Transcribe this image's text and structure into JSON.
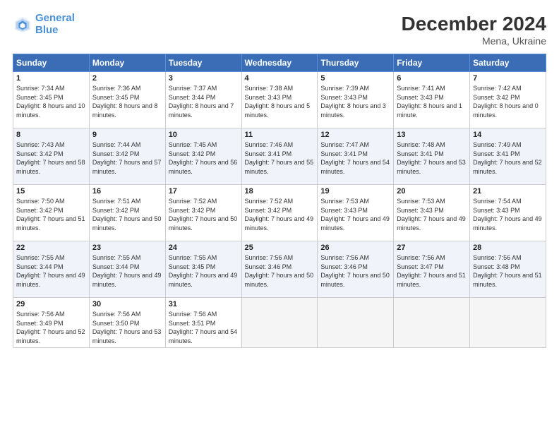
{
  "header": {
    "logo_line1": "General",
    "logo_line2": "Blue",
    "title": "December 2024",
    "subtitle": "Mena, Ukraine"
  },
  "columns": [
    "Sunday",
    "Monday",
    "Tuesday",
    "Wednesday",
    "Thursday",
    "Friday",
    "Saturday"
  ],
  "rows": [
    [
      {
        "day": "1",
        "sunrise": "Sunrise: 7:34 AM",
        "sunset": "Sunset: 3:45 PM",
        "daylight": "Daylight: 8 hours and 10 minutes."
      },
      {
        "day": "2",
        "sunrise": "Sunrise: 7:36 AM",
        "sunset": "Sunset: 3:45 PM",
        "daylight": "Daylight: 8 hours and 8 minutes."
      },
      {
        "day": "3",
        "sunrise": "Sunrise: 7:37 AM",
        "sunset": "Sunset: 3:44 PM",
        "daylight": "Daylight: 8 hours and 7 minutes."
      },
      {
        "day": "4",
        "sunrise": "Sunrise: 7:38 AM",
        "sunset": "Sunset: 3:43 PM",
        "daylight": "Daylight: 8 hours and 5 minutes."
      },
      {
        "day": "5",
        "sunrise": "Sunrise: 7:39 AM",
        "sunset": "Sunset: 3:43 PM",
        "daylight": "Daylight: 8 hours and 3 minutes."
      },
      {
        "day": "6",
        "sunrise": "Sunrise: 7:41 AM",
        "sunset": "Sunset: 3:43 PM",
        "daylight": "Daylight: 8 hours and 1 minute."
      },
      {
        "day": "7",
        "sunrise": "Sunrise: 7:42 AM",
        "sunset": "Sunset: 3:42 PM",
        "daylight": "Daylight: 8 hours and 0 minutes."
      }
    ],
    [
      {
        "day": "8",
        "sunrise": "Sunrise: 7:43 AM",
        "sunset": "Sunset: 3:42 PM",
        "daylight": "Daylight: 7 hours and 58 minutes."
      },
      {
        "day": "9",
        "sunrise": "Sunrise: 7:44 AM",
        "sunset": "Sunset: 3:42 PM",
        "daylight": "Daylight: 7 hours and 57 minutes."
      },
      {
        "day": "10",
        "sunrise": "Sunrise: 7:45 AM",
        "sunset": "Sunset: 3:42 PM",
        "daylight": "Daylight: 7 hours and 56 minutes."
      },
      {
        "day": "11",
        "sunrise": "Sunrise: 7:46 AM",
        "sunset": "Sunset: 3:41 PM",
        "daylight": "Daylight: 7 hours and 55 minutes."
      },
      {
        "day": "12",
        "sunrise": "Sunrise: 7:47 AM",
        "sunset": "Sunset: 3:41 PM",
        "daylight": "Daylight: 7 hours and 54 minutes."
      },
      {
        "day": "13",
        "sunrise": "Sunrise: 7:48 AM",
        "sunset": "Sunset: 3:41 PM",
        "daylight": "Daylight: 7 hours and 53 minutes."
      },
      {
        "day": "14",
        "sunrise": "Sunrise: 7:49 AM",
        "sunset": "Sunset: 3:41 PM",
        "daylight": "Daylight: 7 hours and 52 minutes."
      }
    ],
    [
      {
        "day": "15",
        "sunrise": "Sunrise: 7:50 AM",
        "sunset": "Sunset: 3:42 PM",
        "daylight": "Daylight: 7 hours and 51 minutes."
      },
      {
        "day": "16",
        "sunrise": "Sunrise: 7:51 AM",
        "sunset": "Sunset: 3:42 PM",
        "daylight": "Daylight: 7 hours and 50 minutes."
      },
      {
        "day": "17",
        "sunrise": "Sunrise: 7:52 AM",
        "sunset": "Sunset: 3:42 PM",
        "daylight": "Daylight: 7 hours and 50 minutes."
      },
      {
        "day": "18",
        "sunrise": "Sunrise: 7:52 AM",
        "sunset": "Sunset: 3:42 PM",
        "daylight": "Daylight: 7 hours and 49 minutes."
      },
      {
        "day": "19",
        "sunrise": "Sunrise: 7:53 AM",
        "sunset": "Sunset: 3:43 PM",
        "daylight": "Daylight: 7 hours and 49 minutes."
      },
      {
        "day": "20",
        "sunrise": "Sunrise: 7:53 AM",
        "sunset": "Sunset: 3:43 PM",
        "daylight": "Daylight: 7 hours and 49 minutes."
      },
      {
        "day": "21",
        "sunrise": "Sunrise: 7:54 AM",
        "sunset": "Sunset: 3:43 PM",
        "daylight": "Daylight: 7 hours and 49 minutes."
      }
    ],
    [
      {
        "day": "22",
        "sunrise": "Sunrise: 7:55 AM",
        "sunset": "Sunset: 3:44 PM",
        "daylight": "Daylight: 7 hours and 49 minutes."
      },
      {
        "day": "23",
        "sunrise": "Sunrise: 7:55 AM",
        "sunset": "Sunset: 3:44 PM",
        "daylight": "Daylight: 7 hours and 49 minutes."
      },
      {
        "day": "24",
        "sunrise": "Sunrise: 7:55 AM",
        "sunset": "Sunset: 3:45 PM",
        "daylight": "Daylight: 7 hours and 49 minutes."
      },
      {
        "day": "25",
        "sunrise": "Sunrise: 7:56 AM",
        "sunset": "Sunset: 3:46 PM",
        "daylight": "Daylight: 7 hours and 50 minutes."
      },
      {
        "day": "26",
        "sunrise": "Sunrise: 7:56 AM",
        "sunset": "Sunset: 3:46 PM",
        "daylight": "Daylight: 7 hours and 50 minutes."
      },
      {
        "day": "27",
        "sunrise": "Sunrise: 7:56 AM",
        "sunset": "Sunset: 3:47 PM",
        "daylight": "Daylight: 7 hours and 51 minutes."
      },
      {
        "day": "28",
        "sunrise": "Sunrise: 7:56 AM",
        "sunset": "Sunset: 3:48 PM",
        "daylight": "Daylight: 7 hours and 51 minutes."
      }
    ],
    [
      {
        "day": "29",
        "sunrise": "Sunrise: 7:56 AM",
        "sunset": "Sunset: 3:49 PM",
        "daylight": "Daylight: 7 hours and 52 minutes."
      },
      {
        "day": "30",
        "sunrise": "Sunrise: 7:56 AM",
        "sunset": "Sunset: 3:50 PM",
        "daylight": "Daylight: 7 hours and 53 minutes."
      },
      {
        "day": "31",
        "sunrise": "Sunrise: 7:56 AM",
        "sunset": "Sunset: 3:51 PM",
        "daylight": "Daylight: 7 hours and 54 minutes."
      },
      null,
      null,
      null,
      null
    ]
  ]
}
